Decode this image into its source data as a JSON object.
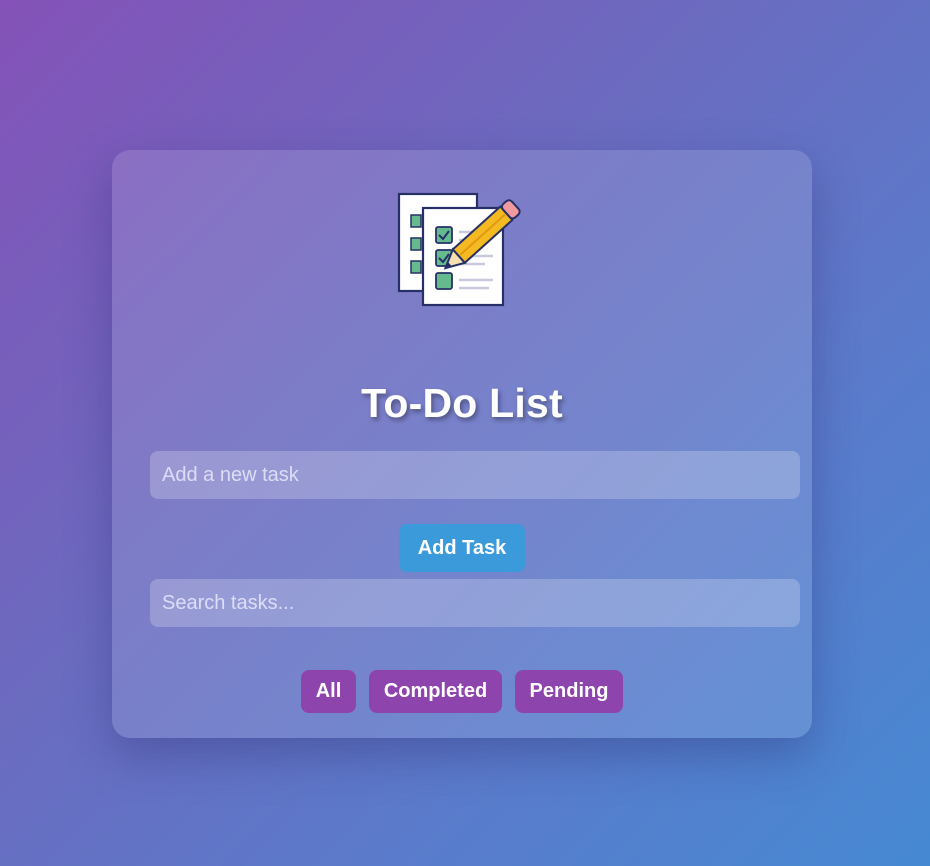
{
  "app": {
    "title": "To-Do List",
    "logo_icon": "checklist-pencil-icon"
  },
  "new_task": {
    "placeholder": "Add a new task",
    "value": ""
  },
  "add_button": {
    "label": "Add Task"
  },
  "search": {
    "placeholder": "Search tasks...",
    "value": ""
  },
  "filters": [
    {
      "label": "All"
    },
    {
      "label": "Completed"
    },
    {
      "label": "Pending"
    }
  ],
  "colors": {
    "add_button": "#3a9ada",
    "filter_button": "#8e44ad",
    "background_start": "#8452b8",
    "background_end": "#4689d3"
  }
}
